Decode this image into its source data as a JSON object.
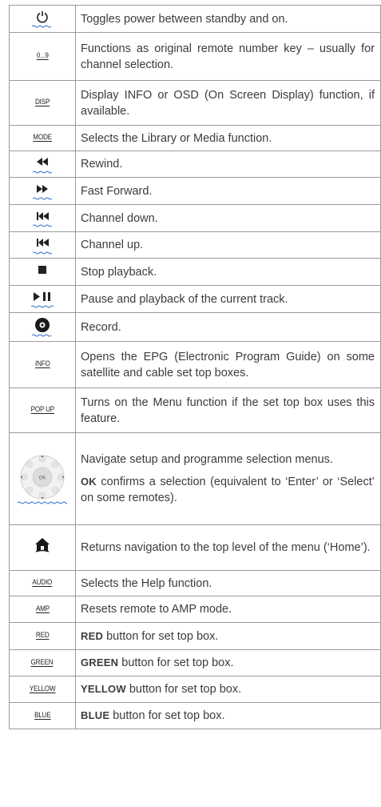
{
  "rows": [
    {
      "key": "power-icon",
      "key_text": "",
      "desc": "Toggles power between standby and on."
    },
    {
      "key": "text",
      "key_text": "0...9",
      "desc": "Functions as original remote number key – usually for channel selection."
    },
    {
      "key": "text",
      "key_text": "DISP",
      "desc": "Display INFO or OSD (On Screen Display) function, if available."
    },
    {
      "key": "text",
      "key_text": "MODE",
      "desc": "Selects the Library or Media function."
    },
    {
      "key": "rewind-icon",
      "key_text": "",
      "desc": "Rewind."
    },
    {
      "key": "fast-forward-icon",
      "key_text": "",
      "desc": "Fast Forward."
    },
    {
      "key": "skip-back-icon",
      "key_text": "",
      "desc": "Channel down."
    },
    {
      "key": "skip-back-icon",
      "key_text": "",
      "desc": "Channel up."
    },
    {
      "key": "stop-icon",
      "key_text": "",
      "desc": "Stop playback."
    },
    {
      "key": "play-pause-icon",
      "key_text": "",
      "desc": "Pause and playback of the current track."
    },
    {
      "key": "record-icon",
      "key_text": "",
      "desc": "Record."
    },
    {
      "key": "text",
      "key_text": "INFO",
      "desc": "Opens the EPG (Electronic Program Guide) on some satellite and cable set top boxes."
    },
    {
      "key": "text",
      "key_text": "POP UP",
      "desc": "Turns on the Menu function if the set top box uses this feature."
    },
    {
      "key": "navigation-pad-icon",
      "key_text": "OK",
      "desc": "Navigate setup and programme selection menus.",
      "desc2_bold": "OK",
      "desc2": " confirms a selection (equivalent to ‘Enter’ or ‘Select’ on some remotes)."
    },
    {
      "key": "home-icon",
      "key_text": "",
      "desc": "Returns navigation to the top level of the menu (‘Home’)."
    },
    {
      "key": "text",
      "key_text": "AUDIO",
      "desc": "Selects the Help function."
    },
    {
      "key": "text",
      "key_text": "AMP",
      "desc": "Resets remote to AMP mode."
    },
    {
      "key": "text",
      "key_text": "RED",
      "desc_bold": "RED",
      "desc": " button for set top box."
    },
    {
      "key": "text",
      "key_text": "GREEN",
      "desc_bold": "GREEN",
      "desc": " button for set top box."
    },
    {
      "key": "text",
      "key_text": "YELLOW",
      "desc_bold": "YELLOW",
      "desc": " button for set top box."
    },
    {
      "key": "text",
      "key_text": "BLUE",
      "desc_bold": "BLUE",
      "desc": " button for set top box."
    }
  ],
  "colors": {
    "border": "#9a9a9a",
    "wave": "#2f6fd1",
    "text": "#3c3c3c"
  }
}
